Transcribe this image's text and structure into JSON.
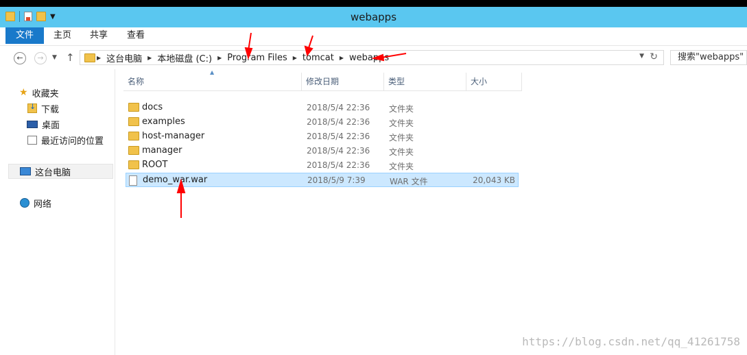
{
  "window": {
    "title": "webapps"
  },
  "ribbon": {
    "tabs": [
      "文件",
      "主页",
      "共享",
      "查看"
    ]
  },
  "address": {
    "crumbs": [
      "这台电脑",
      "本地磁盘 (C:)",
      "Program Files",
      "tomcat",
      "webapps"
    ]
  },
  "search": {
    "placeholder": "搜索\"webapps\""
  },
  "sidebar": {
    "favorites": "收藏夹",
    "items": [
      "下载",
      "桌面",
      "最近访问的位置"
    ],
    "this_pc": "这台电脑",
    "network": "网络"
  },
  "columns": {
    "name": "名称",
    "date": "修改日期",
    "type": "类型",
    "size": "大小"
  },
  "files": [
    {
      "name": "docs",
      "date": "2018/5/4 22:36",
      "type": "文件夹",
      "size": "",
      "icon": "folder-icon"
    },
    {
      "name": "examples",
      "date": "2018/5/4 22:36",
      "type": "文件夹",
      "size": "",
      "icon": "folder-icon"
    },
    {
      "name": "host-manager",
      "date": "2018/5/4 22:36",
      "type": "文件夹",
      "size": "",
      "icon": "folder-icon"
    },
    {
      "name": "manager",
      "date": "2018/5/4 22:36",
      "type": "文件夹",
      "size": "",
      "icon": "folder-icon"
    },
    {
      "name": "ROOT",
      "date": "2018/5/4 22:36",
      "type": "文件夹",
      "size": "",
      "icon": "folder-icon"
    },
    {
      "name": "demo_war.war",
      "date": "2018/5/9 7:39",
      "type": "WAR 文件",
      "size": "20,043 KB",
      "icon": "file-icon",
      "selected": true
    }
  ],
  "watermark": "https://blog.csdn.net/qq_41261758",
  "colors": {
    "titlebar": "#5ac7f0",
    "file_tab": "#1979ca",
    "selection": "#cce8ff",
    "annotation_arrow": "#ff0000"
  }
}
